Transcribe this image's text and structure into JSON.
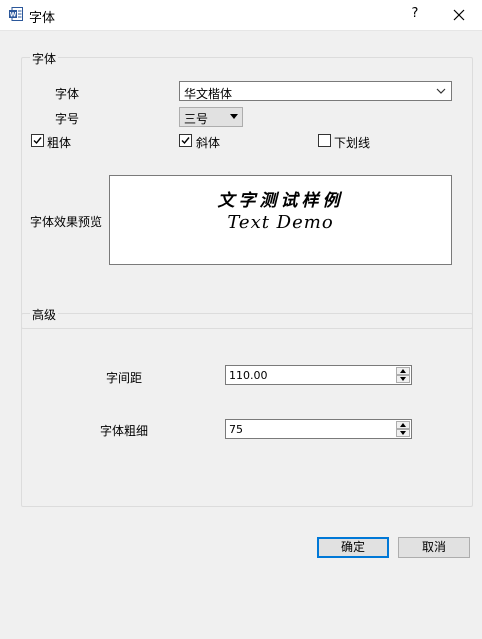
{
  "window": {
    "title": "字体",
    "help_label": "?",
    "app_icon": "word-doc-icon",
    "close_icon": "close-icon"
  },
  "font_group": {
    "title": "字体",
    "font_label": "字体",
    "font_value": "华文楷体",
    "size_label": "字号",
    "size_value": "三号",
    "bold_label": "粗体",
    "bold_checked": true,
    "italic_label": "斜体",
    "italic_checked": true,
    "underline_label": "下划线",
    "underline_checked": false,
    "preview_label": "字体效果预览",
    "preview_line1": "文字测试样例",
    "preview_line2": "Text Demo"
  },
  "advanced_group": {
    "title": "高级",
    "spacing_label": "字间距",
    "spacing_value": "110.00",
    "weight_label": "字体粗细",
    "weight_value": "75"
  },
  "buttons": {
    "ok_label": "确定",
    "cancel_label": "取消"
  },
  "colors": {
    "default_button_border": "#0078d7",
    "dialog_bg": "#f0f0f0"
  }
}
